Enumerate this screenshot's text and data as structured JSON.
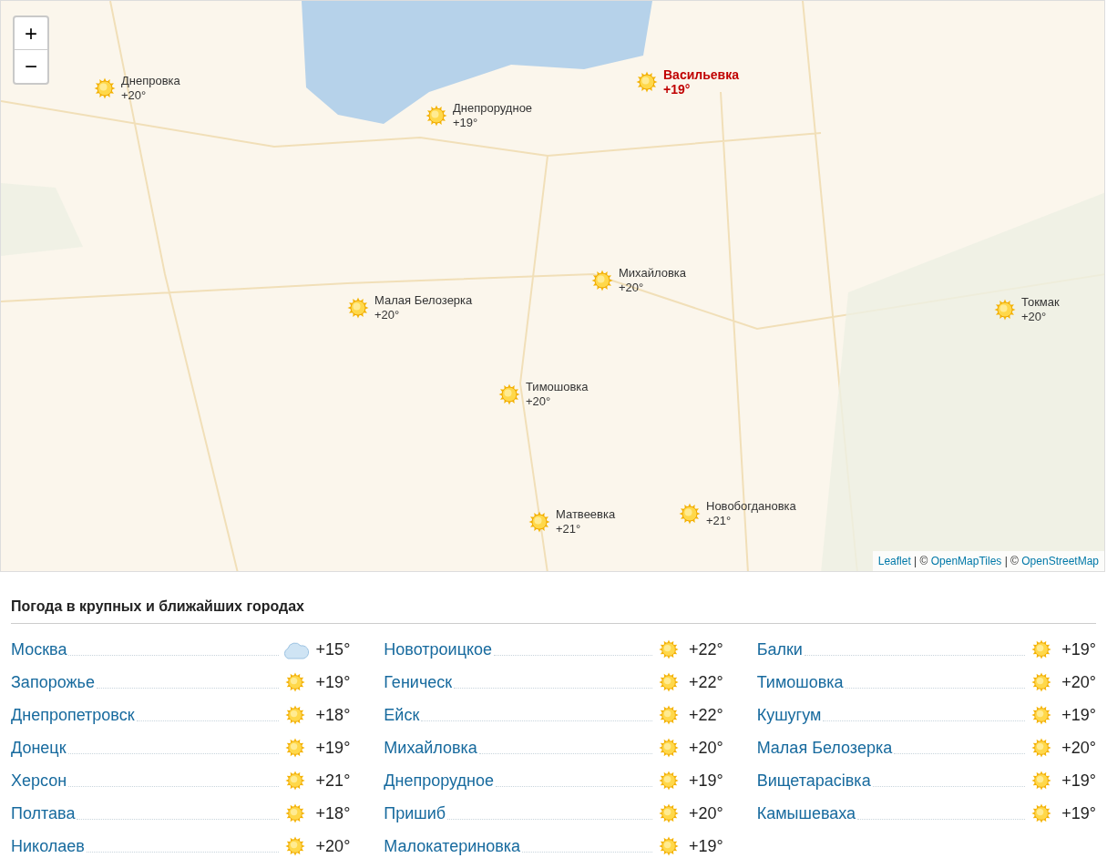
{
  "map": {
    "zoom_controls": [
      "+",
      "−"
    ],
    "markers": [
      {
        "name": "Днепровка",
        "temp": "+20°",
        "kind": "sunny",
        "highlighted": false
      },
      {
        "name": "Днепрорудное",
        "temp": "+19°",
        "kind": "sunny",
        "highlighted": false
      },
      {
        "name": "Васильевка",
        "temp": "+19°",
        "kind": "sunny",
        "highlighted": true
      },
      {
        "name": "Михайловка",
        "temp": "+20°",
        "kind": "sunny",
        "highlighted": false
      },
      {
        "name": "Малая Белозерка",
        "temp": "+20°",
        "kind": "sunny",
        "highlighted": false
      },
      {
        "name": "Токмак",
        "temp": "+20°",
        "kind": "sunny",
        "highlighted": false
      },
      {
        "name": "Тимошовка",
        "temp": "+20°",
        "kind": "sunny",
        "highlighted": false
      },
      {
        "name": "Матвеевка",
        "temp": "+21°",
        "kind": "sunny",
        "highlighted": false
      },
      {
        "name": "Новобогдановка",
        "temp": "+21°",
        "kind": "sunny",
        "highlighted": false
      }
    ],
    "attribution": [
      {
        "text": "Leaflet",
        "kind": "link"
      },
      {
        "text": " | © ",
        "kind": "text"
      },
      {
        "text": "OpenMapTiles",
        "kind": "link"
      },
      {
        "text": " | © ",
        "kind": "text"
      },
      {
        "text": "OpenStreetMap",
        "kind": "link"
      }
    ]
  },
  "cities": {
    "title": "Погода в крупных и ближайших городах",
    "columns": [
      [
        {
          "name": "Москва",
          "kind": "cloudy",
          "temp": "+15°"
        },
        {
          "name": "Запорожье",
          "kind": "sunny",
          "temp": "+19°"
        },
        {
          "name": "Днепропетровск",
          "kind": "sunny",
          "temp": "+18°"
        },
        {
          "name": "Донецк",
          "kind": "sunny",
          "temp": "+19°"
        },
        {
          "name": "Херсон",
          "kind": "sunny",
          "temp": "+21°"
        },
        {
          "name": "Полтава",
          "kind": "sunny",
          "temp": "+18°"
        },
        {
          "name": "Николаев",
          "kind": "sunny",
          "temp": "+20°"
        }
      ],
      [
        {
          "name": "Новотроицкое",
          "kind": "sunny",
          "temp": "+22°"
        },
        {
          "name": "Геническ",
          "kind": "sunny",
          "temp": "+22°"
        },
        {
          "name": "Ейск",
          "kind": "sunny",
          "temp": "+22°"
        },
        {
          "name": "Михайловка",
          "kind": "sunny",
          "temp": "+20°"
        },
        {
          "name": "Днепрорудное",
          "kind": "sunny",
          "temp": "+19°"
        },
        {
          "name": "Пришиб",
          "kind": "sunny",
          "temp": "+20°"
        },
        {
          "name": "Малокатериновка",
          "kind": "sunny",
          "temp": "+19°"
        }
      ],
      [
        {
          "name": "Балки",
          "kind": "sunny",
          "temp": "+19°"
        },
        {
          "name": "Тимошовка",
          "kind": "sunny",
          "temp": "+20°"
        },
        {
          "name": "Кушугум",
          "kind": "sunny",
          "temp": "+19°"
        },
        {
          "name": "Малая Белозерка",
          "kind": "sunny",
          "temp": "+20°"
        },
        {
          "name": "Вищетарасівка",
          "kind": "sunny",
          "temp": "+19°"
        },
        {
          "name": "Камышеваха",
          "kind": "sunny",
          "temp": "+19°"
        }
      ]
    ]
  }
}
